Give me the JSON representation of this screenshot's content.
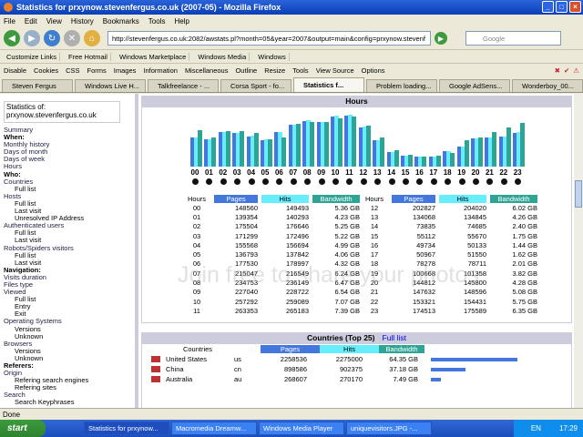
{
  "window": {
    "title": "Statistics for prxynow.stevenfergus.co.uk (2007-05) - Mozilla Firefox"
  },
  "menu": [
    "File",
    "Edit",
    "View",
    "History",
    "Bookmarks",
    "Tools",
    "Help"
  ],
  "nav": {
    "url": "http://stevenfergus.co.uk:2082/awstats.pl?month=05&year=2007&output=main&config=prxynow.stevenf",
    "search_placeholder": "Google"
  },
  "bookmarks": [
    "Customize Links",
    "Free Hotmail",
    "Windows Marketplace",
    "Windows Media",
    "Windows"
  ],
  "devbar": [
    "Disable",
    "Cookies",
    "CSS",
    "Forms",
    "Images",
    "Information",
    "Miscellaneous",
    "Outline",
    "Resize",
    "Tools",
    "View Source",
    "Options"
  ],
  "tabs": [
    "Steven Fergus",
    "Windows Live H...",
    "Talkfreelance - ...",
    "Corsa Sport - fo...",
    "Statistics f...",
    "Problem loading...",
    "Google AdSens...",
    "Wonderboy_00..."
  ],
  "sidebar": {
    "stats_label": "Statistics of:",
    "stats_site": "prxynow.stevenfergus.co.uk",
    "items": [
      {
        "t": "Summary",
        "c": "l"
      },
      {
        "t": "When:",
        "c": "h"
      },
      {
        "t": "Monthly history",
        "c": "l"
      },
      {
        "t": "Days of month",
        "c": "l"
      },
      {
        "t": "Days of week",
        "c": "l"
      },
      {
        "t": "Hours",
        "c": "l"
      },
      {
        "t": "Who:",
        "c": "h"
      },
      {
        "t": "Countries",
        "c": "l"
      },
      {
        "t": "Full list",
        "c": "i2"
      },
      {
        "t": "Hosts",
        "c": "l"
      },
      {
        "t": "Full list",
        "c": "i2"
      },
      {
        "t": "Last visit",
        "c": "i2"
      },
      {
        "t": "Unresolved IP Address",
        "c": "i2"
      },
      {
        "t": "Authenticated users",
        "c": "l"
      },
      {
        "t": "Full list",
        "c": "i2"
      },
      {
        "t": "Last visit",
        "c": "i2"
      },
      {
        "t": "Robots/Spiders visitors",
        "c": "l"
      },
      {
        "t": "Full list",
        "c": "i2"
      },
      {
        "t": "Last visit",
        "c": "i2"
      },
      {
        "t": "Navigation:",
        "c": "h"
      },
      {
        "t": "Visits duration",
        "c": "l"
      },
      {
        "t": "Files type",
        "c": "l"
      },
      {
        "t": "Viewed",
        "c": "l"
      },
      {
        "t": "Full list",
        "c": "i2"
      },
      {
        "t": "Entry",
        "c": "i2"
      },
      {
        "t": "Exit",
        "c": "i2"
      },
      {
        "t": "Operating Systems",
        "c": "l"
      },
      {
        "t": "Versions",
        "c": "i2"
      },
      {
        "t": "Unknown",
        "c": "i2"
      },
      {
        "t": "Browsers",
        "c": "l"
      },
      {
        "t": "Versions",
        "c": "i2"
      },
      {
        "t": "Unknown",
        "c": "i2"
      },
      {
        "t": "Referers:",
        "c": "h"
      },
      {
        "t": "Origin",
        "c": "l"
      },
      {
        "t": "Refering search engines",
        "c": "i2"
      },
      {
        "t": "Refering sites",
        "c": "i2"
      },
      {
        "t": "Search",
        "c": "l"
      },
      {
        "t": "Search Keyphrases",
        "c": "i2"
      }
    ]
  },
  "hours": {
    "title": "Hours",
    "headers": [
      "Hours",
      "Pages",
      "Hits",
      "Bandwidth"
    ],
    "rows": [
      [
        "00",
        "148560",
        "149493",
        "5.36 GB"
      ],
      [
        "01",
        "139354",
        "140293",
        "4.23 GB"
      ],
      [
        "02",
        "175504",
        "176646",
        "5.25 GB"
      ],
      [
        "03",
        "171299",
        "172496",
        "5.22 GB"
      ],
      [
        "04",
        "155568",
        "156694",
        "4.99 GB"
      ],
      [
        "05",
        "136793",
        "137842",
        "4.06 GB"
      ],
      [
        "06",
        "177530",
        "178997",
        "4.32 GB"
      ],
      [
        "07",
        "215047",
        "216549",
        "6.24 GB"
      ],
      [
        "08",
        "234753",
        "236149",
        "6.47 GB"
      ],
      [
        "09",
        "227040",
        "228722",
        "6.54 GB"
      ],
      [
        "10",
        "257292",
        "259089",
        "7.07 GB"
      ],
      [
        "11",
        "263353",
        "265183",
        "7.39 GB"
      ],
      [
        "12",
        "202827",
        "204020",
        "6.02 GB"
      ],
      [
        "13",
        "134068",
        "134845",
        "4.26 GB"
      ],
      [
        "14",
        "73835",
        "74685",
        "2.40 GB"
      ],
      [
        "15",
        "55112",
        "55670",
        "1.75 GB"
      ],
      [
        "16",
        "49734",
        "50133",
        "1.44 GB"
      ],
      [
        "17",
        "50967",
        "51550",
        "1.62 GB"
      ],
      [
        "18",
        "78278",
        "78711",
        "2.01 GB"
      ],
      [
        "19",
        "100668",
        "101358",
        "3.82 GB"
      ],
      [
        "20",
        "144812",
        "145800",
        "4.28 GB"
      ],
      [
        "21",
        "147632",
        "148596",
        "5.08 GB"
      ],
      [
        "22",
        "153321",
        "154431",
        "5.75 GB"
      ],
      [
        "23",
        "174513",
        "175589",
        "6.35 GB"
      ]
    ],
    "colors": {
      "pages": "#4477dd",
      "hits": "#66eeff",
      "bandwidth": "#2ea495"
    }
  },
  "countries": {
    "title": "Countries (Top 25)",
    "full_list": "Full list",
    "headers": [
      "Countries",
      "Pages",
      "Hits",
      "Bandwidth"
    ],
    "rows": [
      {
        "name": "United States",
        "code": "us",
        "pages": "2258536",
        "hits": "2275000",
        "bw": "64.35 GB",
        "p": 1.0
      },
      {
        "name": "China",
        "code": "cn",
        "pages": "898586",
        "hits": "902375",
        "bw": "37.18 GB",
        "p": 0.4
      },
      {
        "name": "Australia",
        "code": "au",
        "pages": "268607",
        "hits": "270170",
        "bw": "7.49 GB",
        "p": 0.12
      }
    ]
  },
  "watermark": "Join free to share your photos.",
  "status": "Done",
  "taskbar": {
    "start": "start",
    "buttons": [
      "Statistics for prxynow...",
      "Macromedia Dreamw...",
      "Windows Media Player",
      "uniquevisitors.JPG -..."
    ],
    "lang": "EN",
    "clock": "17:29"
  }
}
